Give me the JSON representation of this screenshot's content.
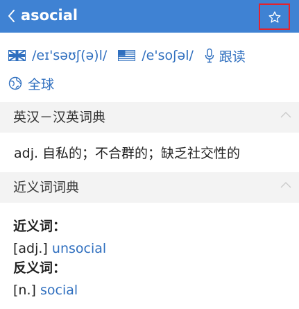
{
  "header": {
    "word": "asocial"
  },
  "pronunciation": {
    "uk": "/eɪ'səʊʃ(ə)l/",
    "us": "/e'soʃəl/",
    "read_label": "跟读",
    "global_label": "全球"
  },
  "dictionaries": [
    {
      "title": "英汉－汉英词典",
      "definition": "adj. 自私的；不合群的；缺乏社交性的"
    },
    {
      "title": "近义词词典",
      "synonyms_label": "近义词：",
      "synonyms": [
        {
          "pos": "[adj.]",
          "word": "unsocial"
        }
      ],
      "antonyms_label": "反义词：",
      "antonyms": [
        {
          "pos": "[n.]",
          "word": "social"
        }
      ]
    }
  ],
  "colors": {
    "accent": "#3f82d3",
    "link": "#2f6fbf",
    "highlight": "#e3232d",
    "section_bg": "#f3f3f3"
  }
}
